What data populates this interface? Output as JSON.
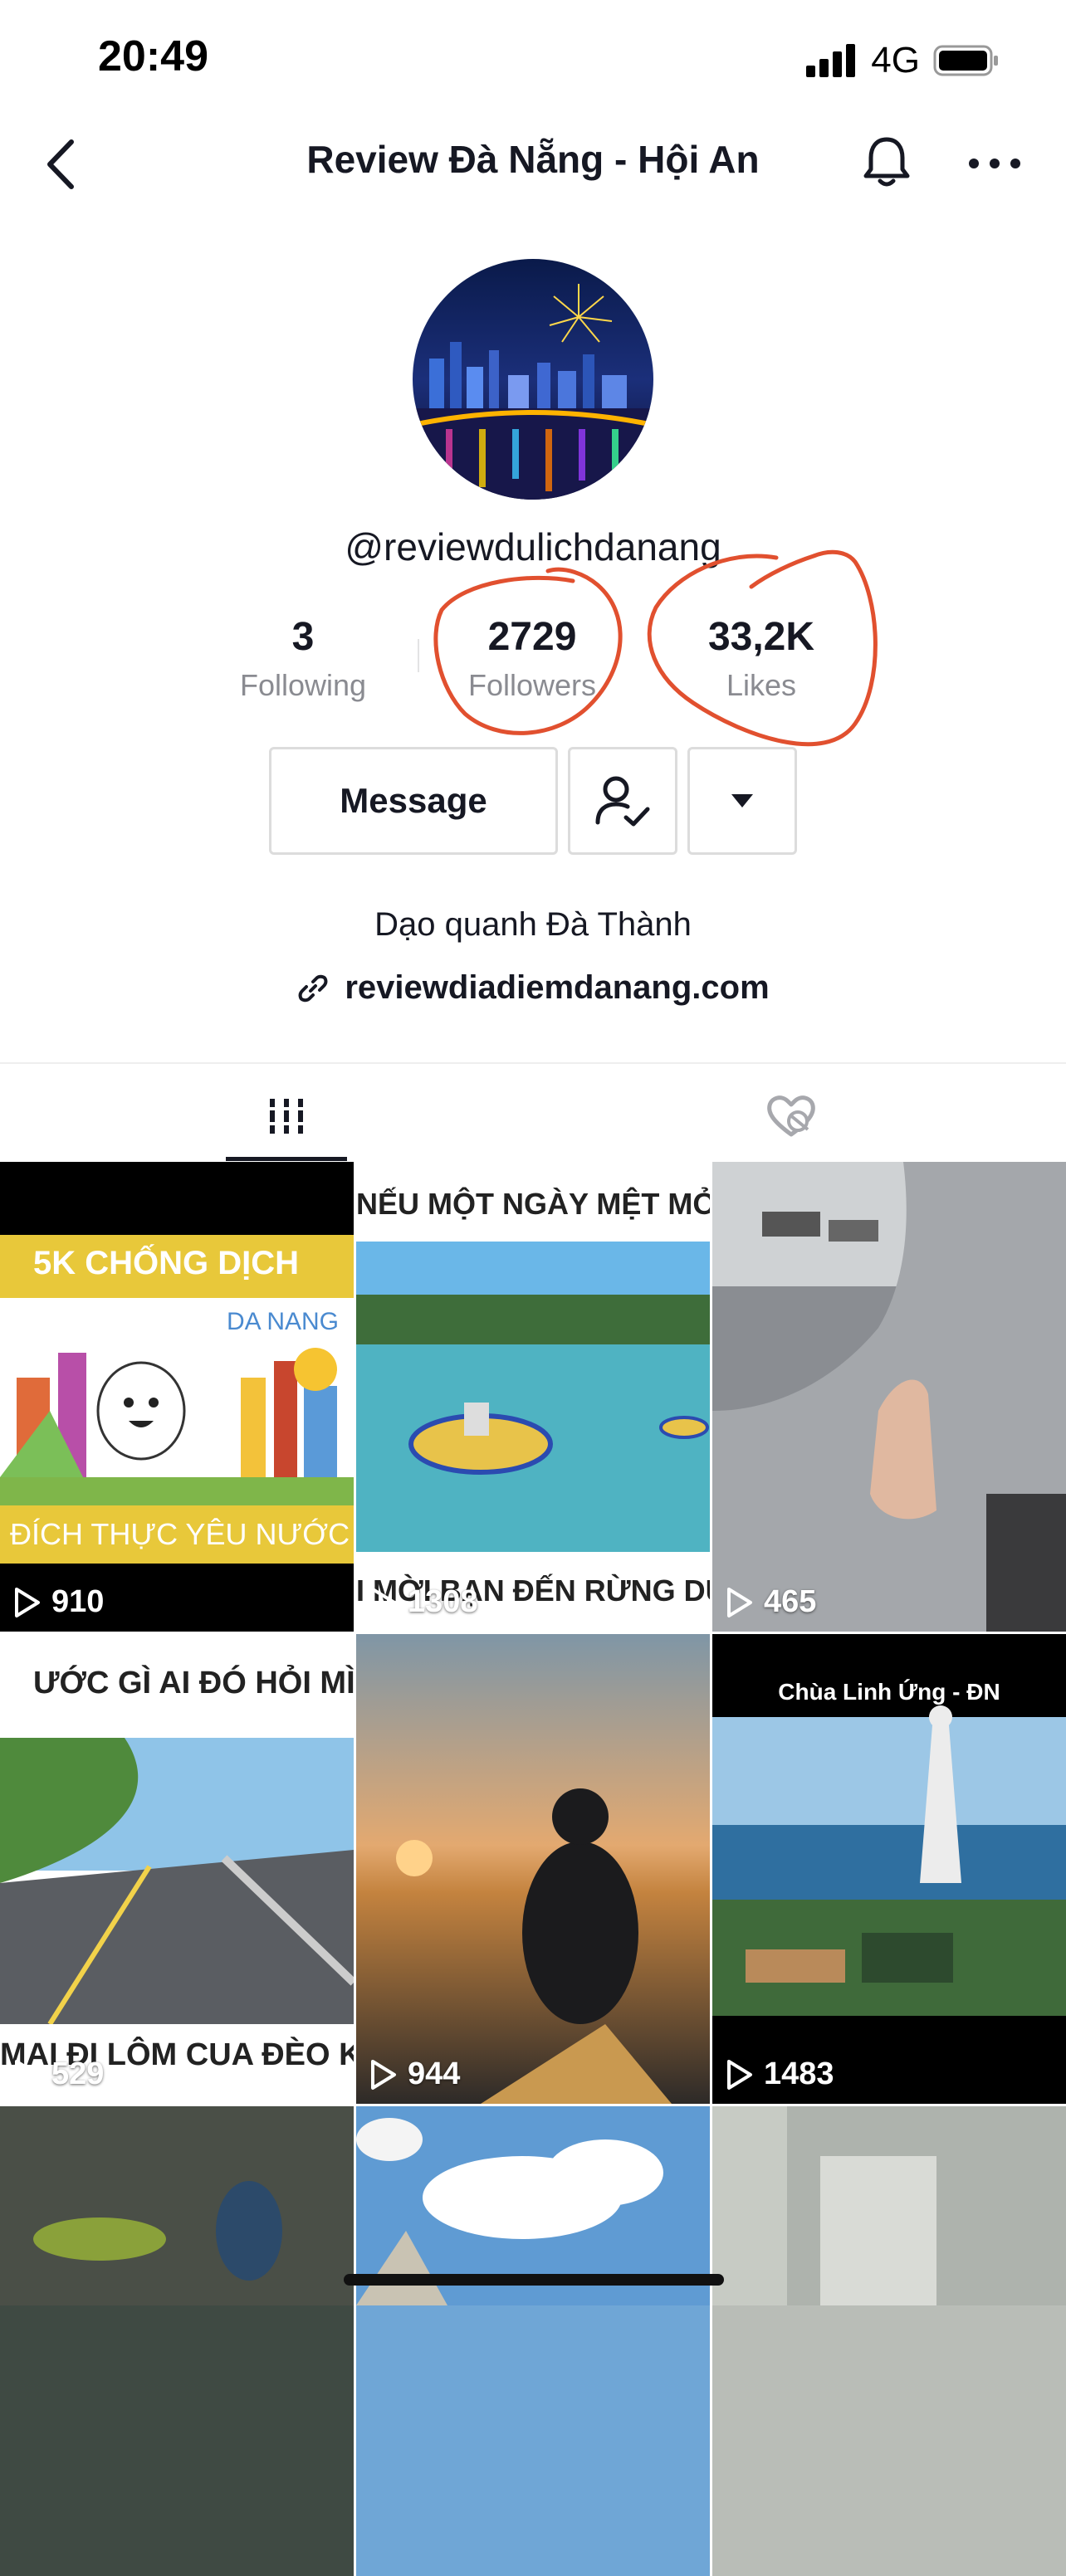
{
  "status_bar": {
    "time": "20:49",
    "network": "4G"
  },
  "header": {
    "title": "Review Đà Nẵng - Hội An"
  },
  "profile": {
    "username": "@reviewdulichdanang",
    "stats": {
      "following": {
        "value": "3",
        "label": "Following"
      },
      "followers": {
        "value": "2729",
        "label": "Followers"
      },
      "likes": {
        "value": "33,2K",
        "label": "Likes"
      }
    },
    "message_label": "Message",
    "bio": "Dạo quanh Đà Thành",
    "link": "reviewdiadiemdanang.com"
  },
  "videos": [
    {
      "views": "910",
      "caption_top": "5K CHỐNG DỊCH",
      "caption_sub": "DA NANG",
      "caption_bottom": "ĐÍCH THỰC YÊU NƯỚC"
    },
    {
      "views": "1308",
      "caption_top": "NẾU MỘT NGÀY MỆT MỎI VỚI ĐỜ",
      "caption_bottom": "I MỜI BẠN ĐẾN RỪNG DỪA BẢY M"
    },
    {
      "views": "465"
    },
    {
      "views": "529",
      "caption_top": "ƯỚC GÌ AI ĐÓ HỎI MÌNH",
      "caption_bottom": "MAI ĐI LÔM CUA ĐÈO KHÔNG?"
    },
    {
      "views": "944"
    },
    {
      "views": "1483",
      "caption_top": "Chùa Linh Ứng - ĐN"
    },
    {
      "views": ""
    },
    {
      "views": ""
    },
    {
      "views": ""
    }
  ],
  "colors": {
    "annotation": "#e1502f",
    "text": "#161823",
    "muted": "#8a8b91"
  }
}
